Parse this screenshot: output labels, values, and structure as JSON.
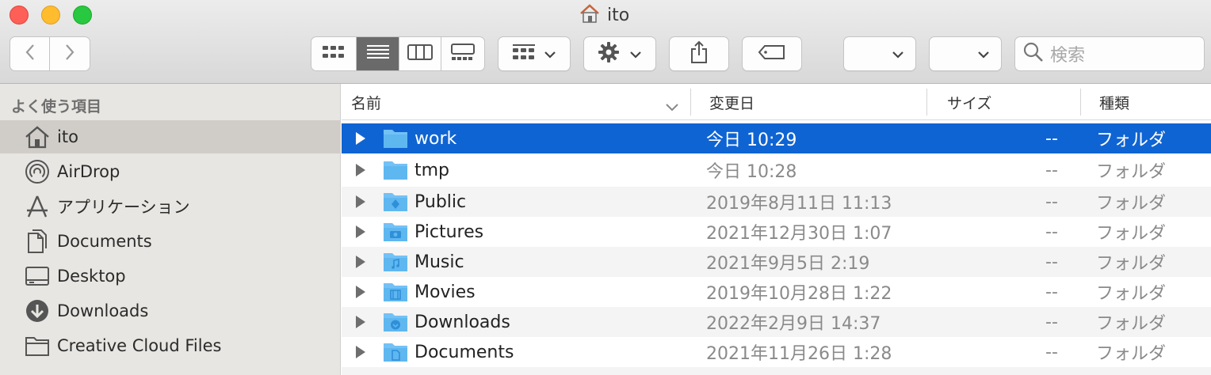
{
  "window": {
    "title": "ito"
  },
  "toolbar": {
    "back_icon": "chevron-left-icon",
    "forward_icon": "chevron-right-icon",
    "view_modes": [
      "icon-view",
      "list-view",
      "column-view",
      "gallery-view"
    ],
    "selected_view": "list-view",
    "group_icon": "group-grid-icon",
    "action_icon": "gear-icon",
    "share_icon": "share-icon",
    "tag_icon": "tag-icon",
    "search_placeholder": "検索"
  },
  "sidebar": {
    "section_title": "よく使う項目",
    "items": [
      {
        "label": "ito",
        "icon": "home-icon",
        "selected": true
      },
      {
        "label": "AirDrop",
        "icon": "airdrop-icon",
        "selected": false
      },
      {
        "label": "アプリケーション",
        "icon": "applications-icon",
        "selected": false
      },
      {
        "label": "Documents",
        "icon": "documents-icon",
        "selected": false
      },
      {
        "label": "Desktop",
        "icon": "desktop-icon",
        "selected": false
      },
      {
        "label": "Downloads",
        "icon": "downloads-icon",
        "selected": false
      },
      {
        "label": "Creative Cloud Files",
        "icon": "folder-icon",
        "selected": false
      }
    ]
  },
  "list": {
    "columns": {
      "name": "名前",
      "modified": "変更日",
      "size": "サイズ",
      "kind": "種類"
    },
    "rows": [
      {
        "name": "work",
        "modified": "今日 10:29",
        "size": "--",
        "kind": "フォルダ",
        "selected": true
      },
      {
        "name": "tmp",
        "modified": "今日 10:28",
        "size": "--",
        "kind": "フォルダ",
        "selected": false
      },
      {
        "name": "Public",
        "modified": "2019年8月11日 11:13",
        "size": "--",
        "kind": "フォルダ",
        "selected": false
      },
      {
        "name": "Pictures",
        "modified": "2021年12月30日 1:07",
        "size": "--",
        "kind": "フォルダ",
        "selected": false
      },
      {
        "name": "Music",
        "modified": "2021年9月5日 2:19",
        "size": "--",
        "kind": "フォルダ",
        "selected": false
      },
      {
        "name": "Movies",
        "modified": "2019年10月28日 1:22",
        "size": "--",
        "kind": "フォルダ",
        "selected": false
      },
      {
        "name": "Downloads",
        "modified": "2022年2月9日 14:37",
        "size": "--",
        "kind": "フォルダ",
        "selected": false
      },
      {
        "name": "Documents",
        "modified": "2021年11月26日 1:28",
        "size": "--",
        "kind": "フォルダ",
        "selected": false
      }
    ]
  },
  "colors": {
    "selection": "#0f64d3",
    "folder": "#5fb7f0",
    "sidebar_bg": "#e8e6e2"
  }
}
